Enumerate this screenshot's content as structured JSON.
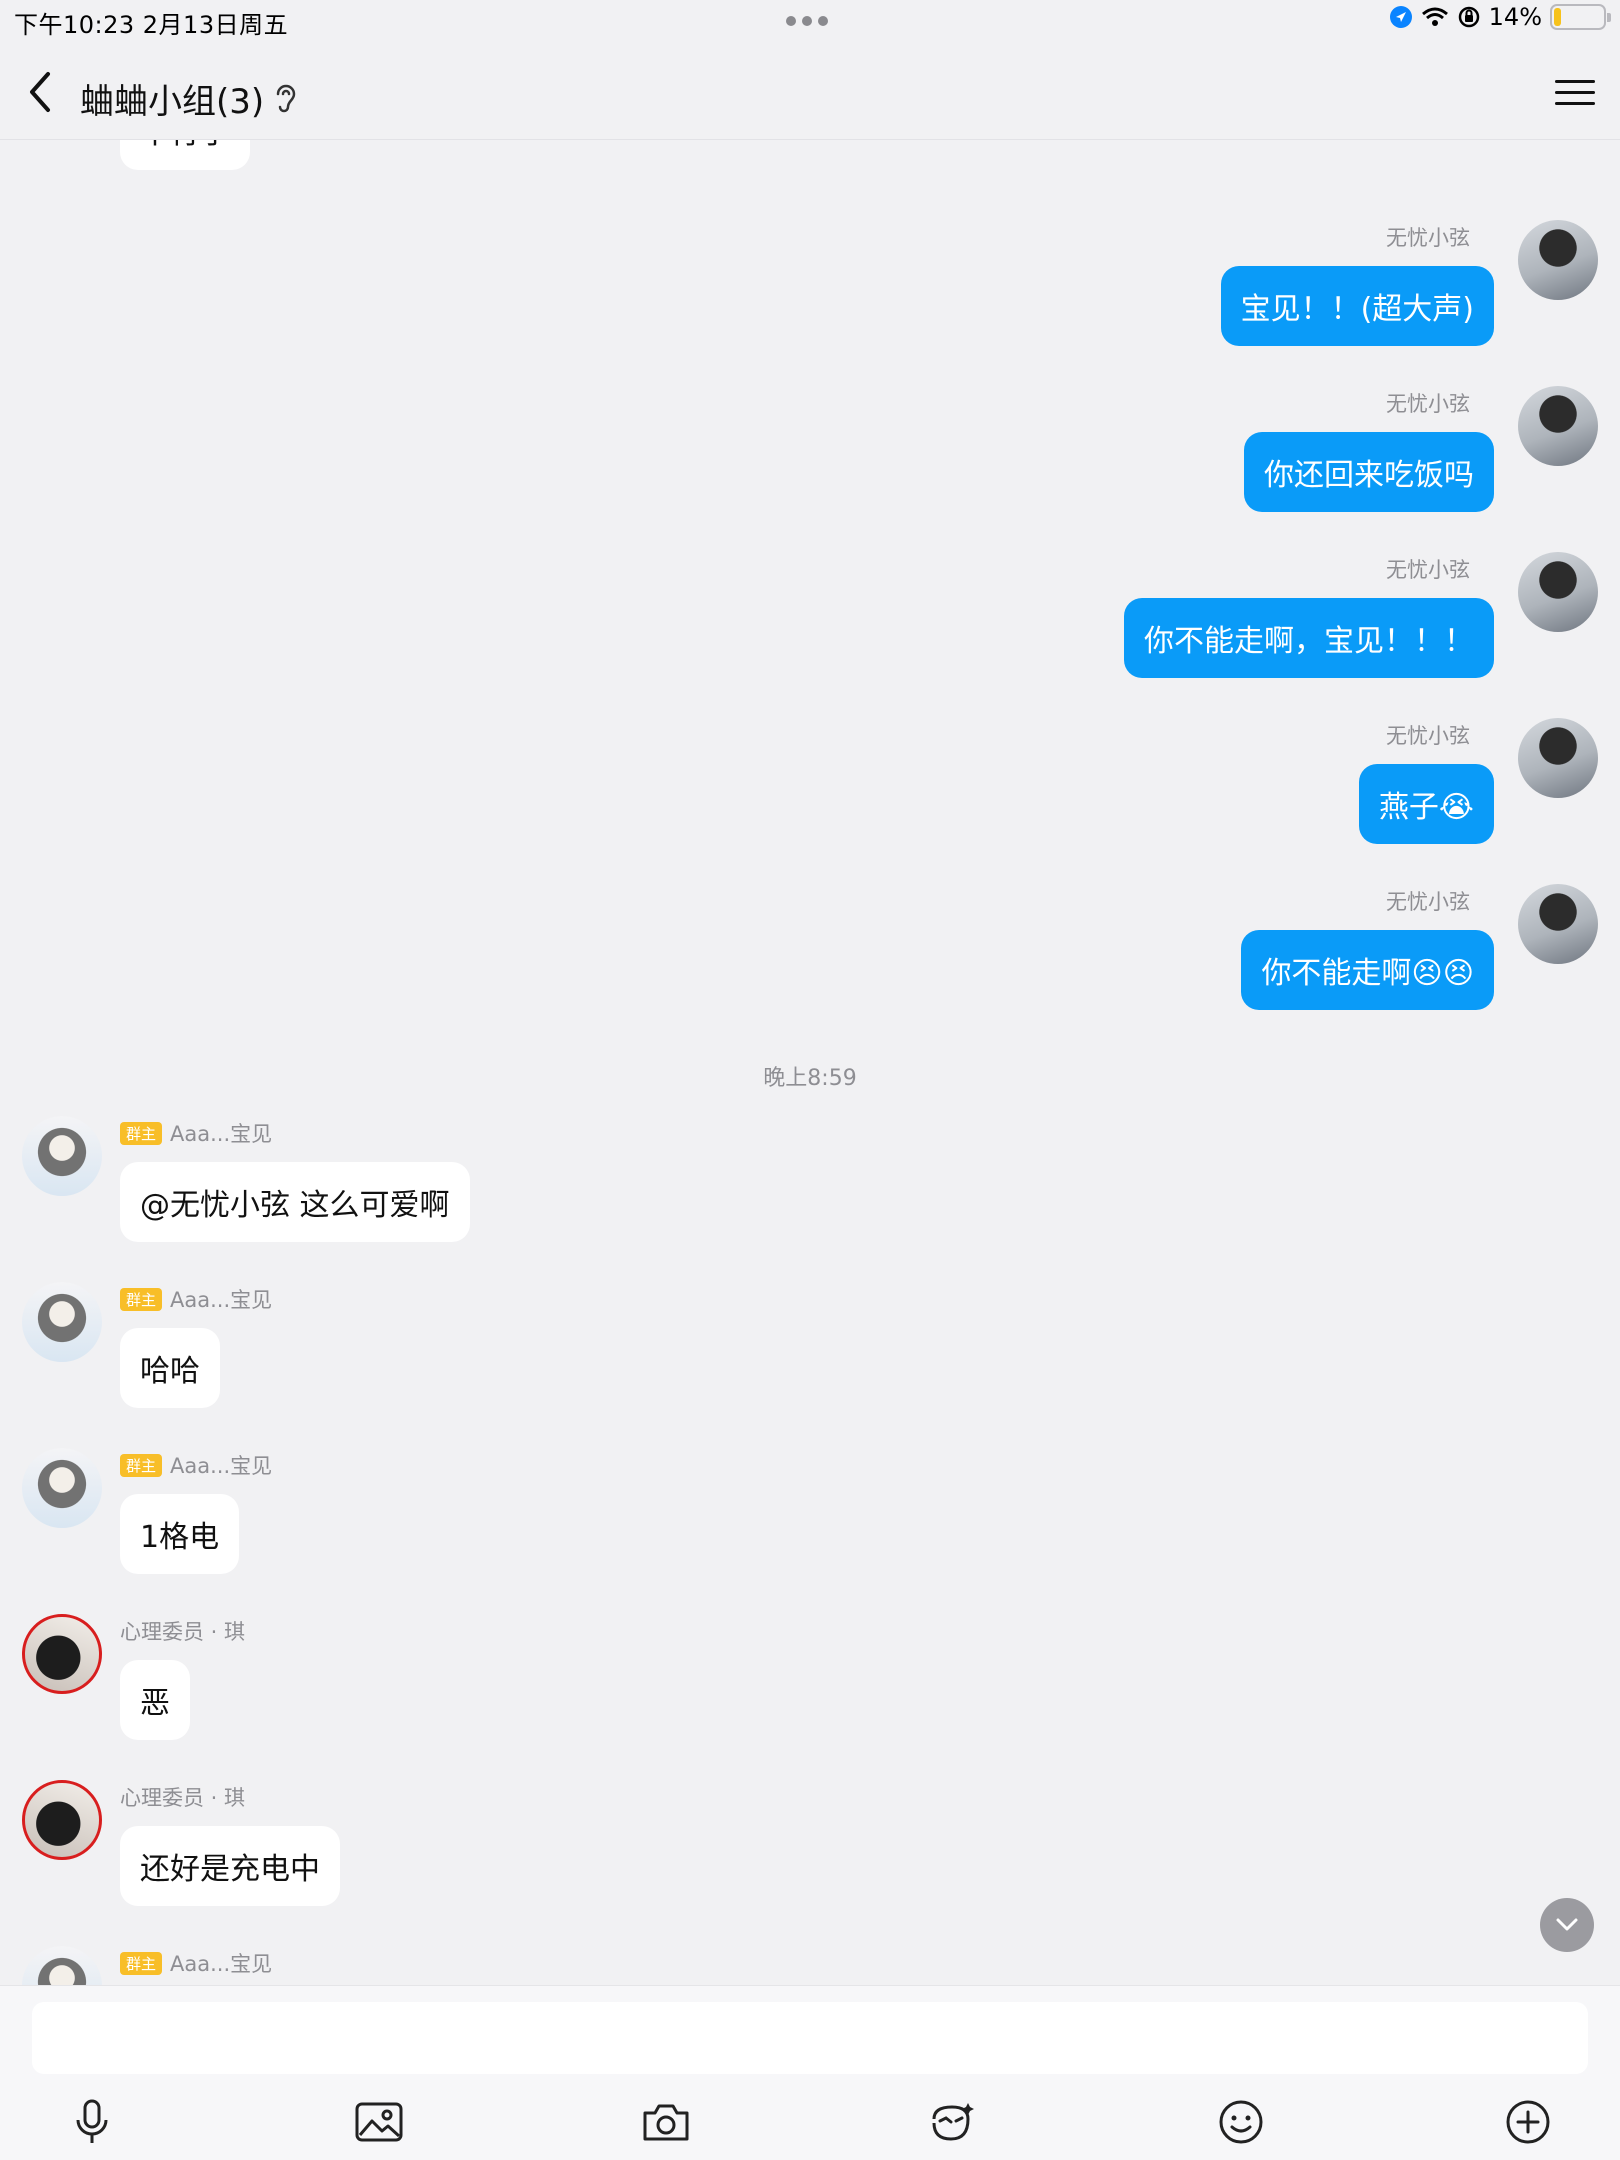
{
  "status_bar": {
    "datetime": "下午10:23   2月13日周五",
    "battery": "14%"
  },
  "header": {
    "title": "蛐蛐小组(3)"
  },
  "chat": {
    "partial_top": {
      "text": "不行了"
    },
    "outgoing": [
      {
        "sender": "无忧小弦",
        "text": "宝见！！(超大声)"
      },
      {
        "sender": "无忧小弦",
        "text": "你还回来吃饭吗"
      },
      {
        "sender": "无忧小弦",
        "text": "你不能走啊，宝见！！！"
      },
      {
        "sender": "无忧小弦",
        "text": "燕子😭"
      },
      {
        "sender": "无忧小弦",
        "text": "你不能走啊😣😣"
      }
    ],
    "time_separator": "晚上8:59",
    "incoming": [
      {
        "badge": "群主",
        "sender": "Aaa...宝见",
        "text": "@无忧小弦 这么可爱啊"
      },
      {
        "badge": "群主",
        "sender": "Aaa...宝见",
        "text": "哈哈"
      },
      {
        "badge": "群主",
        "sender": "Aaa...宝见",
        "text": "1格电"
      },
      {
        "badge": "",
        "sender": "心理委员 · 琪",
        "text": "恶"
      },
      {
        "badge": "",
        "sender": "心理委员 · 琪",
        "text": "还好是充电中"
      },
      {
        "badge": "群主",
        "sender": "Aaa...宝见",
        "text": ""
      }
    ]
  },
  "composer": {
    "value": "",
    "placeholder": ""
  },
  "icons": {
    "toolbar": [
      "microphone-icon",
      "image-icon",
      "camera-icon",
      "sticker-icon",
      "emoji-icon",
      "plus-icon"
    ]
  },
  "colors": {
    "outgoing_bubble": "#0a9bf8",
    "owner_badge": "#f8be28",
    "background": "#f1f1f3"
  }
}
